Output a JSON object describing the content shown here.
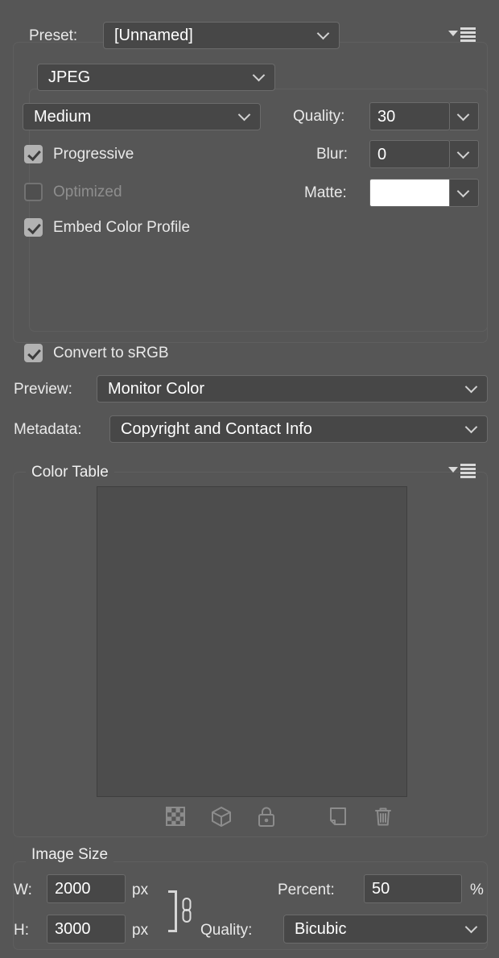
{
  "panel": {
    "preset": {
      "label": "Preset:",
      "value": "[Unnamed]",
      "menu_icon": "panel-flyout-menu-icon"
    },
    "format": {
      "value": "JPEG"
    },
    "quality_preset": {
      "value": "Medium"
    },
    "quality": {
      "label": "Quality:",
      "value": "30"
    },
    "blur": {
      "label": "Blur:",
      "value": "0"
    },
    "matte": {
      "label": "Matte:",
      "color": "#ffffff"
    },
    "checkboxes": [
      {
        "name": "progressive",
        "label": "Progressive",
        "checked": true,
        "disabled": false
      },
      {
        "name": "optimized",
        "label": "Optimized",
        "checked": false,
        "disabled": true
      },
      {
        "name": "embed-color-profile",
        "label": "Embed Color Profile",
        "checked": true,
        "disabled": false
      },
      {
        "name": "convert-to-srgb",
        "label": "Convert to sRGB",
        "checked": true,
        "disabled": false
      }
    ],
    "preview": {
      "label": "Preview:",
      "value": "Monitor Color"
    },
    "metadata": {
      "label": "Metadata:",
      "value": "Copyright and Contact Info"
    },
    "color_table": {
      "title": "Color Table",
      "menu_icon": "panel-flyout-menu-icon",
      "tools": [
        {
          "name": "transparency-icon",
          "title": "Maps selected colors to transparent"
        },
        {
          "name": "web-safe-cube-icon",
          "title": "Shifts selected colors to web palette"
        },
        {
          "name": "lock-icon",
          "title": "Locks selected colors"
        },
        {
          "name": "new-color-icon",
          "title": "Adds eyedropper color to palette"
        },
        {
          "name": "trash-icon",
          "title": "Deletes selected colors"
        }
      ]
    },
    "image_size": {
      "title": "Image Size",
      "width": {
        "label": "W:",
        "value": "2000",
        "unit": "px"
      },
      "height": {
        "label": "H:",
        "value": "3000",
        "unit": "px"
      },
      "constrain_icon": "chain-link-icon",
      "percent": {
        "label": "Percent:",
        "value": "50",
        "unit": "%"
      },
      "quality": {
        "label": "Quality:",
        "value": "Bicubic"
      }
    }
  },
  "colors": {
    "panel_bg": "#565656",
    "field_bg": "#474747",
    "field_border": "#6b6b6b",
    "text": "#ffffff",
    "text_dim": "#8e8e8e",
    "checkbox_on": "#b2b2b2",
    "color_table_bg": "#4d4d4d",
    "icon": "#8c8c8c"
  }
}
